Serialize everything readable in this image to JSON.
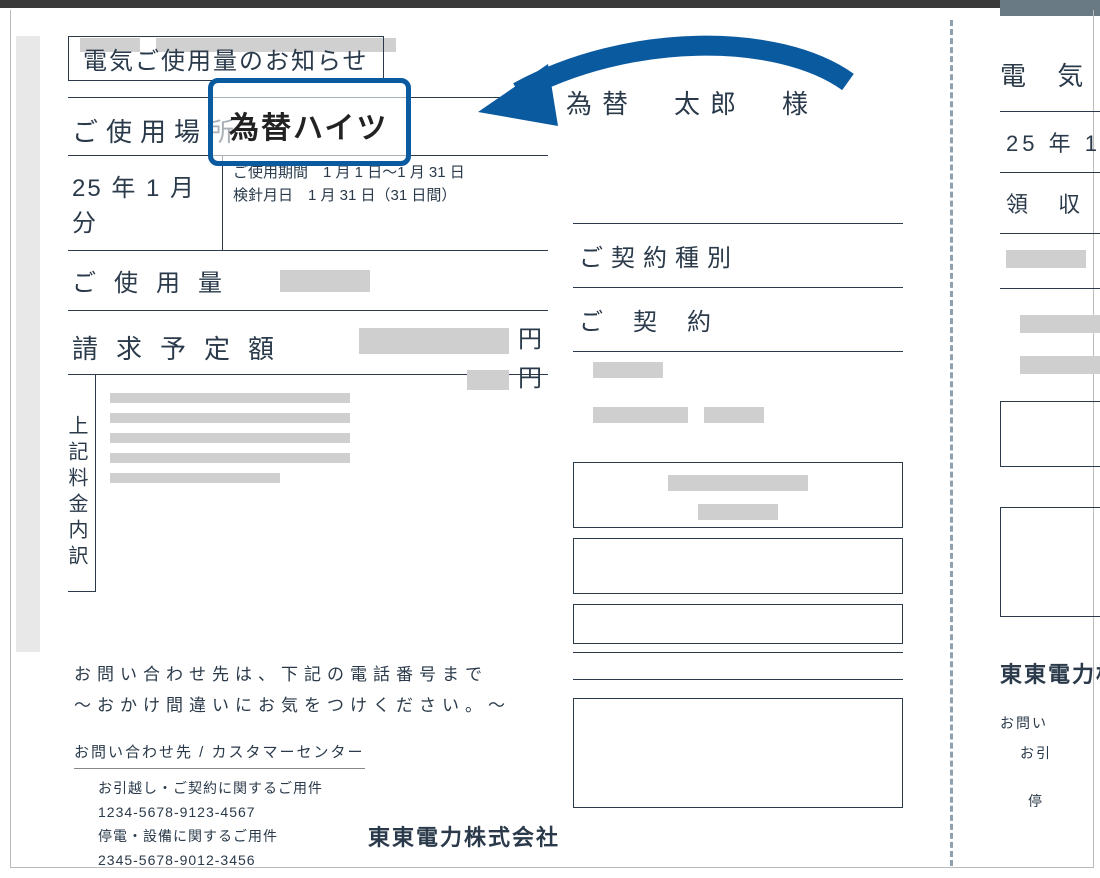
{
  "header": {
    "notice_title": "電気ご使用量のお知らせ",
    "customer_name": "為替　太郎　様"
  },
  "left": {
    "location_label": "ご使用場所",
    "location_value": "為替ハイツ",
    "month_label": "25 年 1 月分",
    "period_label": "ご使用期間　1 月 1 日～1 月 31 日",
    "meter_label": "検針月日　1 月 31 日（31 日間）",
    "usage_label": "ご使用量",
    "bill_label": "請求予定額",
    "yen1": "円",
    "yen2": "円",
    "breakdown_label": "上記料金内訳"
  },
  "right": {
    "contract_type_label": "ご契約種別",
    "contract_label": "ご契約"
  },
  "inquiry": {
    "line1": "お問い合わせ先は、下記の電話番号まで",
    "line2": "～おかけ間違いにお気をつけください。～",
    "sub": "お問い合わせ先 / カスタマーセンター",
    "item1": "お引越し・ご契約に関するご用件",
    "tel1": "1234-5678-9123-4567",
    "item2": "停電・設備に関するご用件",
    "tel2": "2345-5678-9012-3456"
  },
  "company": "東東電力株式会社",
  "right_panel": {
    "title": "電 気",
    "row1": "25 年 1",
    "row2": "領 収 金",
    "company": "東東電力株",
    "inq1": "お問い",
    "inq2": "お引",
    "inq3": "停"
  }
}
